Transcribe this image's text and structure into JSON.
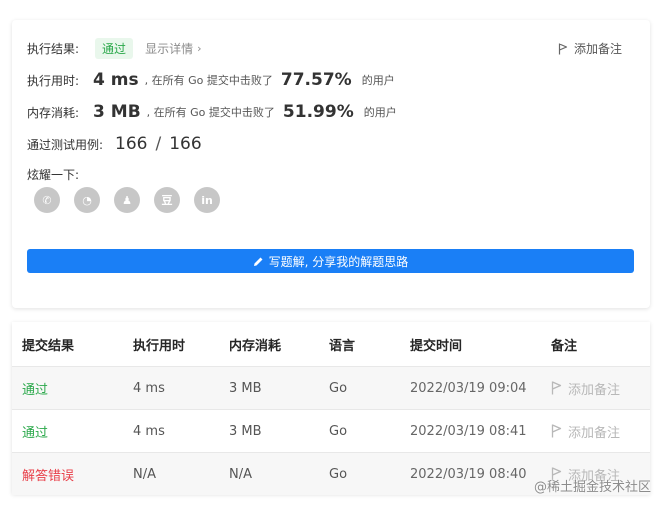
{
  "result": {
    "label": "执行结果:",
    "status": "通过",
    "detail_link": "显示详情",
    "detail_chevron": "›",
    "add_note": "添加备注"
  },
  "runtime": {
    "label": "执行用时:",
    "value": "4 ms",
    "text_before": ", 在所有 Go 提交中击败了",
    "percent": "77.57%",
    "text_after": "的用户"
  },
  "memory": {
    "label": "内存消耗:",
    "value": "3 MB",
    "text_before": ", 在所有 Go 提交中击败了",
    "percent": "51.99%",
    "text_after": "的用户"
  },
  "testcases": {
    "label": "通过测试用例:",
    "passed": "166",
    "separator": "/",
    "total": "166"
  },
  "share": {
    "label": "炫耀一下:",
    "icons": [
      {
        "name": "wechat-icon",
        "glyph": "✆"
      },
      {
        "name": "weibo-icon",
        "glyph": "◔"
      },
      {
        "name": "qq-icon",
        "glyph": "♟"
      },
      {
        "name": "douban-icon",
        "glyph": "豆"
      },
      {
        "name": "linkedin-icon",
        "glyph": "in"
      }
    ]
  },
  "cta": {
    "label": "写题解, 分享我的解题思路",
    "icon": "pencil-icon"
  },
  "submissions": {
    "headers": [
      "提交结果",
      "执行用时",
      "内存消耗",
      "语言",
      "提交时间",
      "备注"
    ],
    "rows": [
      {
        "status": "通过",
        "status_type": "ok",
        "runtime": "4 ms",
        "memory": "3 MB",
        "lang": "Go",
        "time": "2022/03/19 09:04",
        "note": "添加备注"
      },
      {
        "status": "通过",
        "status_type": "ok",
        "runtime": "4 ms",
        "memory": "3 MB",
        "lang": "Go",
        "time": "2022/03/19 08:41",
        "note": "添加备注"
      },
      {
        "status": "解答错误",
        "status_type": "err",
        "runtime": "N/A",
        "memory": "N/A",
        "lang": "Go",
        "time": "2022/03/19 08:40",
        "note": "添加备注"
      }
    ]
  },
  "watermark": "@稀土掘金技术社区",
  "colors": {
    "accept": "#2aa84a",
    "error": "#e8404a",
    "primary": "#1a7ff6"
  }
}
